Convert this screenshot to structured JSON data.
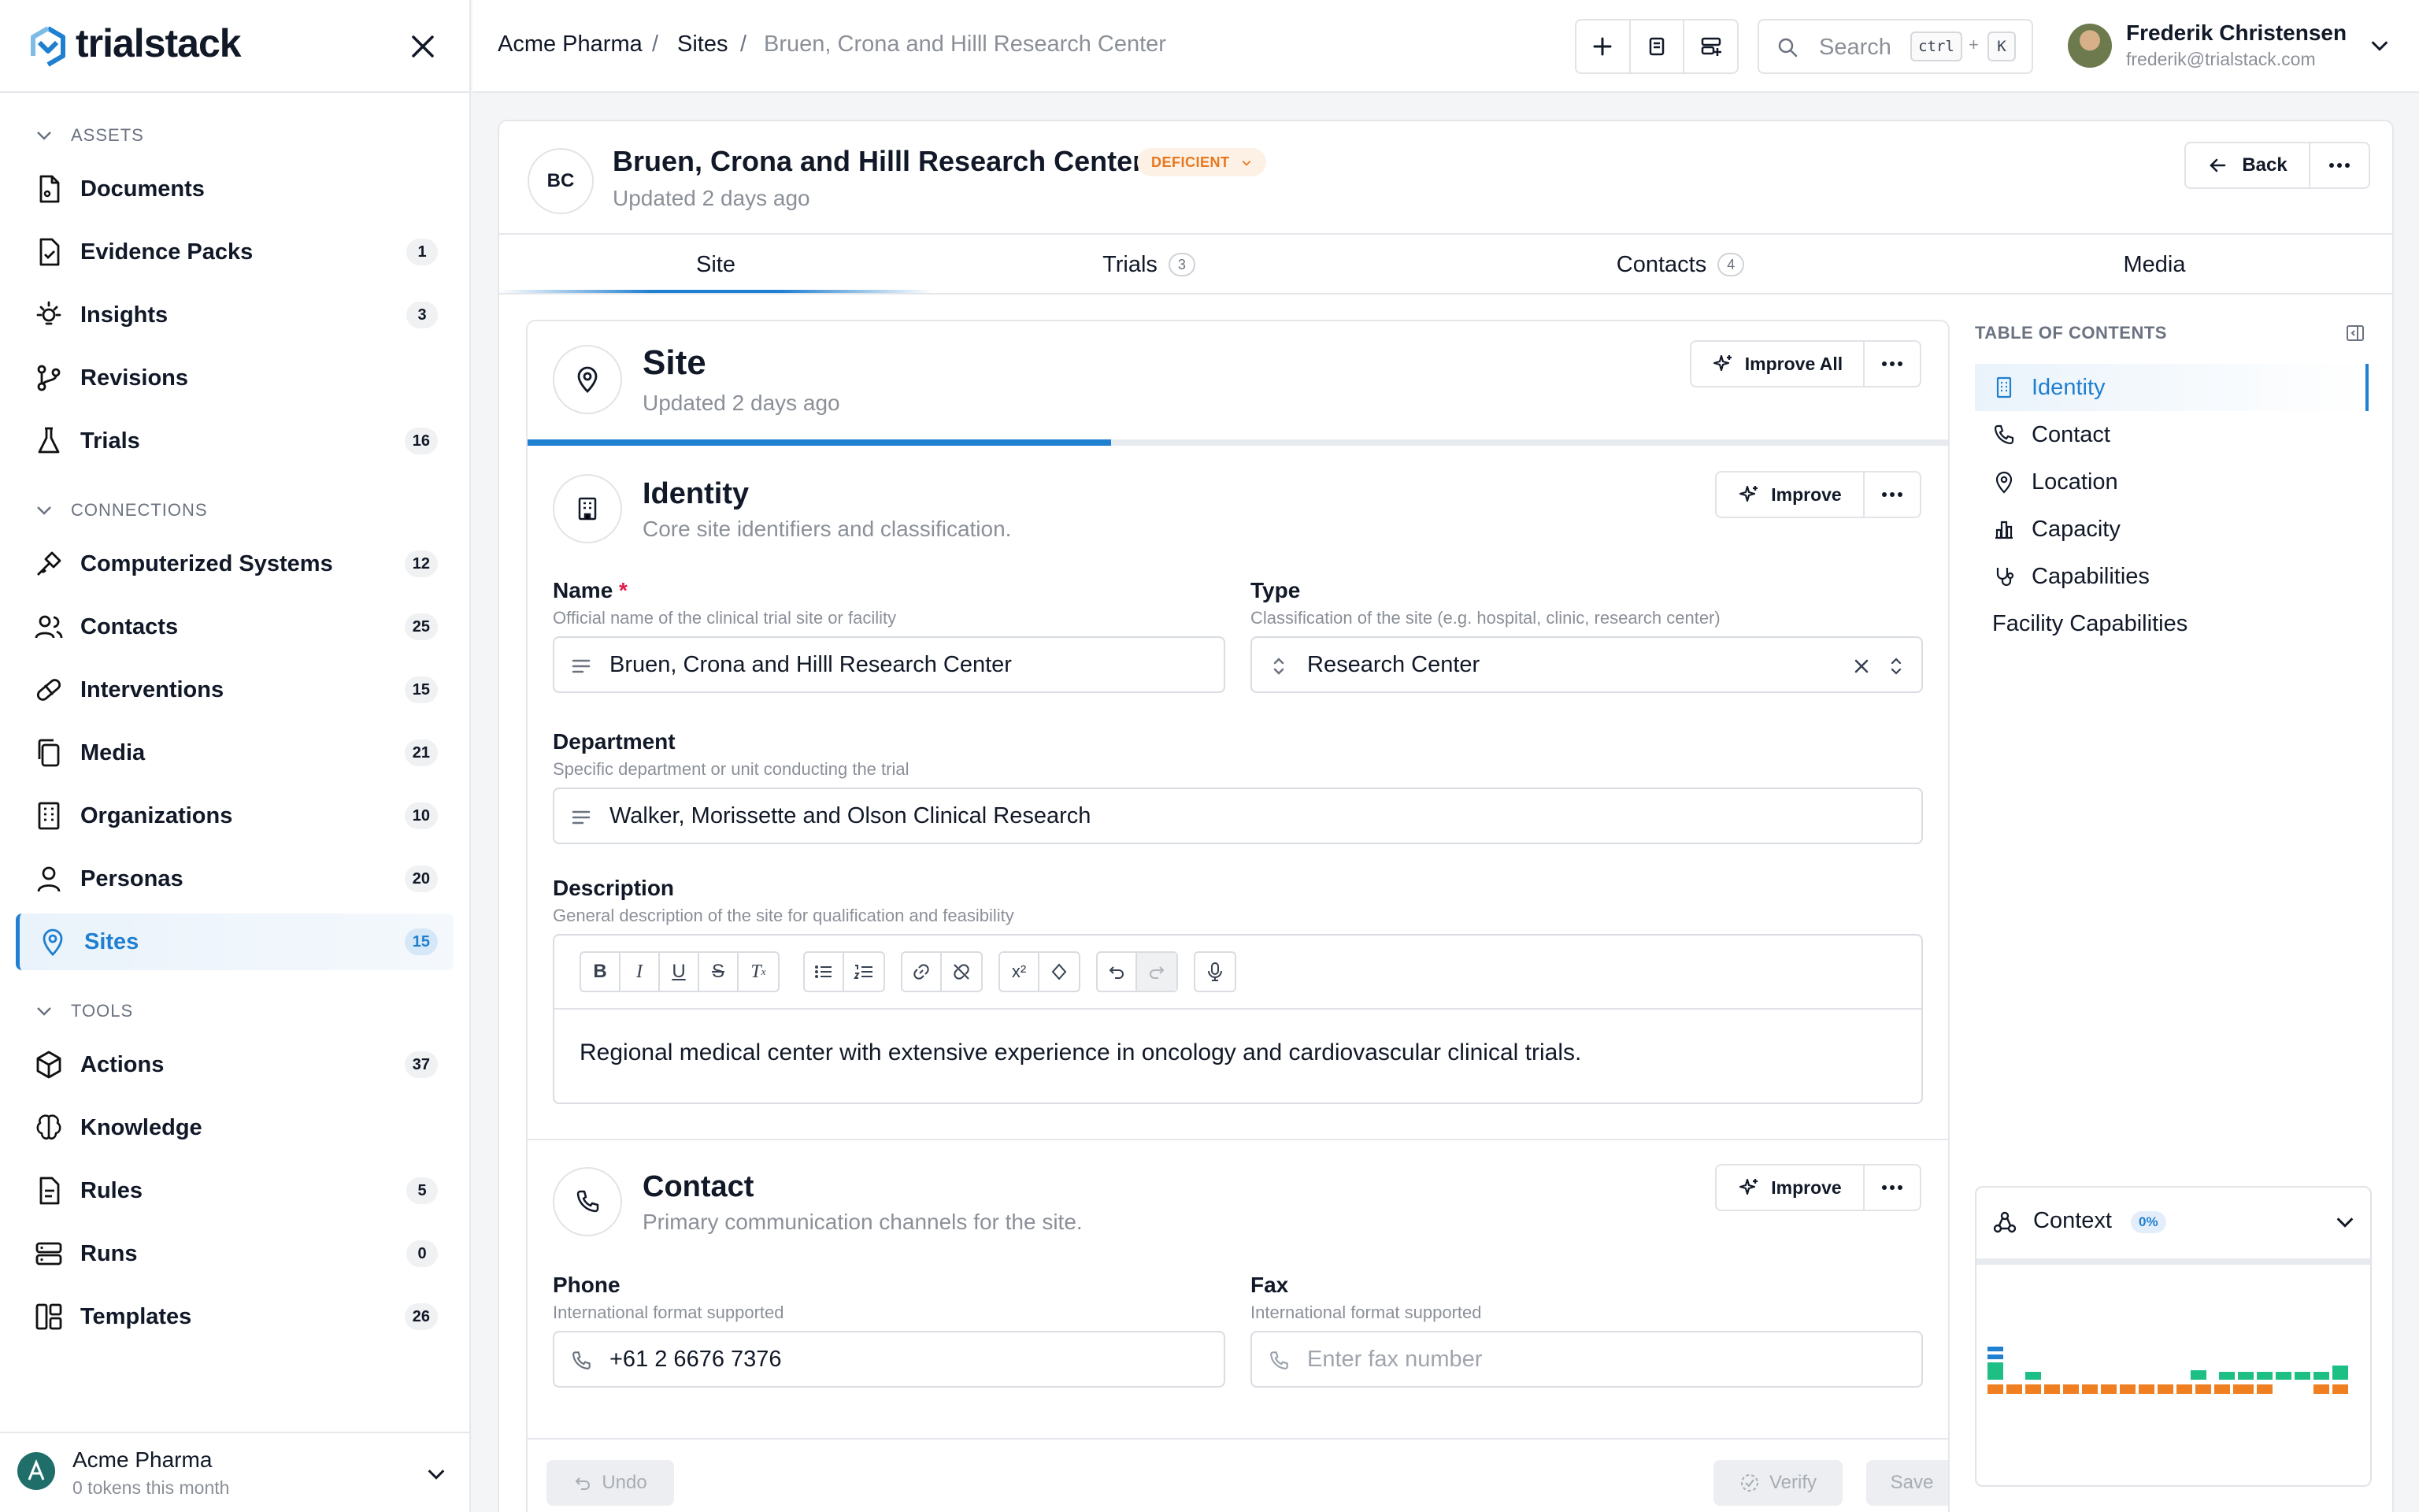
{
  "app": {
    "name": "trialstack"
  },
  "sidebar": {
    "sections": {
      "assets": "ASSETS",
      "connections": "CONNECTIONS",
      "tools": "TOOLS"
    },
    "items": [
      {
        "label": "Documents",
        "count": "",
        "icon": "document-icon"
      },
      {
        "label": "Evidence Packs",
        "count": "1",
        "icon": "evidence-pack-icon"
      },
      {
        "label": "Insights",
        "count": "3",
        "icon": "lightbulb-icon"
      },
      {
        "label": "Revisions",
        "count": "",
        "icon": "git-branch-icon"
      },
      {
        "label": "Trials",
        "count": "16",
        "icon": "flask-icon"
      },
      {
        "label": "Computerized Systems",
        "count": "12",
        "icon": "plug-icon"
      },
      {
        "label": "Contacts",
        "count": "25",
        "icon": "users-icon"
      },
      {
        "label": "Interventions",
        "count": "15",
        "icon": "pill-icon"
      },
      {
        "label": "Media",
        "count": "21",
        "icon": "copy-icon"
      },
      {
        "label": "Organizations",
        "count": "10",
        "icon": "building-icon"
      },
      {
        "label": "Personas",
        "count": "20",
        "icon": "user-icon"
      },
      {
        "label": "Sites",
        "count": "15",
        "icon": "map-pin-icon"
      },
      {
        "label": "Actions",
        "count": "37",
        "icon": "box-icon"
      },
      {
        "label": "Knowledge",
        "count": "",
        "icon": "brain-icon"
      },
      {
        "label": "Rules",
        "count": "5",
        "icon": "rules-icon"
      },
      {
        "label": "Runs",
        "count": "0",
        "icon": "server-icon"
      },
      {
        "label": "Templates",
        "count": "26",
        "icon": "templates-icon"
      }
    ],
    "org": {
      "name": "Acme Pharma",
      "tokens": "0 tokens this month"
    }
  },
  "topbar": {
    "breadcrumb": [
      "Acme Pharma",
      "Sites",
      "Bruen, Crona and Hilll Research Center"
    ],
    "search_placeholder": "Search",
    "shortcut": [
      "ctrl",
      "+",
      "K"
    ],
    "user": {
      "name": "Frederik Christensen",
      "email": "frederik@trialstack.com"
    }
  },
  "header": {
    "initials": "BC",
    "title": "Bruen, Crona and Hilll Research Center",
    "status": "DEFICIENT",
    "updated": "Updated 2 days ago",
    "back_label": "Back"
  },
  "tabs": [
    {
      "label": "Site",
      "count": ""
    },
    {
      "label": "Trials",
      "count": "3"
    },
    {
      "label": "Contacts",
      "count": "4"
    },
    {
      "label": "Media",
      "count": ""
    }
  ],
  "site_section": {
    "title": "Site",
    "updated": "Updated 2 days ago",
    "improve_all": "Improve All",
    "progress": 0.41
  },
  "identity": {
    "title": "Identity",
    "subtitle": "Core site identifiers and classification.",
    "improve": "Improve",
    "name_label": "Name",
    "name_required": "*",
    "name_hint": "Official name of the clinical trial site or facility",
    "name_value": "Bruen, Crona and Hilll Research Center",
    "type_label": "Type",
    "type_hint": "Classification of the site (e.g. hospital, clinic, research center)",
    "type_value": "Research Center",
    "department_label": "Department",
    "department_hint": "Specific department or unit conducting the trial",
    "department_value": "Walker, Morissette and Olson Clinical Research",
    "description_label": "Description",
    "description_hint": "General description of the site for qualification and feasibility",
    "description_value": "Regional medical center with extensive experience in oncology and cardiovascular clinical trials."
  },
  "contact": {
    "title": "Contact",
    "subtitle": "Primary communication channels for the site.",
    "improve": "Improve",
    "phone_label": "Phone",
    "phone_hint": "International format supported",
    "phone_value": "+61 2 6676 7376",
    "fax_label": "Fax",
    "fax_hint": "International format supported",
    "fax_placeholder": "Enter fax number"
  },
  "footer": {
    "undo": "Undo",
    "verify": "Verify",
    "save": "Save"
  },
  "toc": {
    "title": "TABLE OF CONTENTS",
    "items": [
      {
        "label": "Identity",
        "icon": "building-icon"
      },
      {
        "label": "Contact",
        "icon": "phone-icon"
      },
      {
        "label": "Location",
        "icon": "map-pin-icon"
      },
      {
        "label": "Capacity",
        "icon": "bar-chart-icon"
      },
      {
        "label": "Capabilities",
        "icon": "stethoscope-icon"
      },
      {
        "label": "Facility Capabilities",
        "icon": ""
      }
    ]
  },
  "context": {
    "title": "Context",
    "percent": "0%"
  },
  "colors": {
    "accent": "#1f7fd0",
    "deficient": "#e8771d",
    "green": "#1dbf84",
    "orange": "#f07f22"
  }
}
